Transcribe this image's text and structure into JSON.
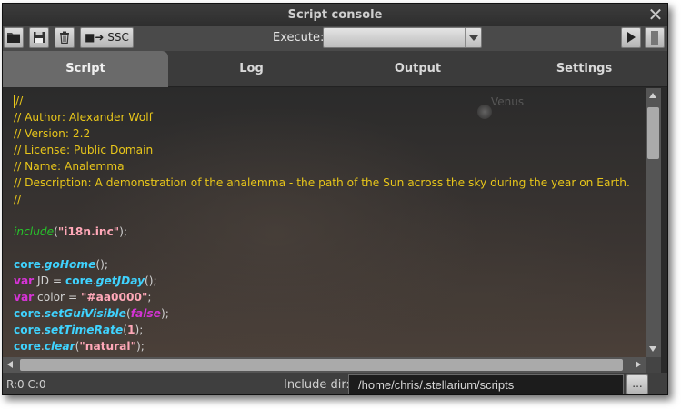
{
  "window": {
    "title": "Script console"
  },
  "toolbar": {
    "ssc_label": "SSC",
    "execute_label": "Execute:",
    "execute_value": ""
  },
  "tabs": [
    {
      "label": "Script",
      "active": true
    },
    {
      "label": "Log",
      "active": false
    },
    {
      "label": "Output",
      "active": false
    },
    {
      "label": "Settings",
      "active": false
    }
  ],
  "editor": {
    "background_label": "Venus",
    "lines": [
      [
        {
          "t": "//",
          "c": "cmt"
        }
      ],
      [
        {
          "t": "// Author: Alexander Wolf",
          "c": "cmt"
        }
      ],
      [
        {
          "t": "// Version: 2.2",
          "c": "cmt"
        }
      ],
      [
        {
          "t": "// License: Public Domain",
          "c": "cmt"
        }
      ],
      [
        {
          "t": "// Name: Analemma",
          "c": "cmt"
        }
      ],
      [
        {
          "t": "// Description: A demonstration of the analemma - the path of the Sun across the sky during the year on Earth.",
          "c": "cmt"
        }
      ],
      [
        {
          "t": "//",
          "c": "cmt"
        }
      ],
      [],
      [
        {
          "t": "include",
          "c": "inc"
        },
        {
          "t": "(",
          "c": "plain"
        },
        {
          "t": "\"i18n.inc\"",
          "c": "str"
        },
        {
          "t": ");",
          "c": "plain"
        }
      ],
      [],
      [
        {
          "t": "core",
          "c": "obj"
        },
        {
          "t": ".",
          "c": "plain"
        },
        {
          "t": "goHome",
          "c": "fn"
        },
        {
          "t": "();",
          "c": "plain"
        }
      ],
      [
        {
          "t": "var",
          "c": "kw"
        },
        {
          "t": " JD = ",
          "c": "plain"
        },
        {
          "t": "core",
          "c": "obj"
        },
        {
          "t": ".",
          "c": "plain"
        },
        {
          "t": "getJDay",
          "c": "fn"
        },
        {
          "t": "();",
          "c": "plain"
        }
      ],
      [
        {
          "t": "var",
          "c": "kw"
        },
        {
          "t": " color = ",
          "c": "plain"
        },
        {
          "t": "\"#aa0000\"",
          "c": "str"
        },
        {
          "t": ";",
          "c": "plain"
        }
      ],
      [
        {
          "t": "core",
          "c": "obj"
        },
        {
          "t": ".",
          "c": "plain"
        },
        {
          "t": "setGuiVisible",
          "c": "fn"
        },
        {
          "t": "(",
          "c": "plain"
        },
        {
          "t": "false",
          "c": "bool"
        },
        {
          "t": ");",
          "c": "plain"
        }
      ],
      [
        {
          "t": "core",
          "c": "obj"
        },
        {
          "t": ".",
          "c": "plain"
        },
        {
          "t": "setTimeRate",
          "c": "fn"
        },
        {
          "t": "(",
          "c": "plain"
        },
        {
          "t": "1",
          "c": "num"
        },
        {
          "t": ");",
          "c": "plain"
        }
      ],
      [
        {
          "t": "core",
          "c": "obj"
        },
        {
          "t": ".",
          "c": "plain"
        },
        {
          "t": "clear",
          "c": "fn"
        },
        {
          "t": "(",
          "c": "plain"
        },
        {
          "t": "\"natural\"",
          "c": "str"
        },
        {
          "t": ");",
          "c": "plain"
        }
      ]
    ]
  },
  "status": {
    "position": "R:0 C:0",
    "include_label": "Include dir:",
    "include_value": "/home/chris/.stellarium/scripts",
    "browse_label": "..."
  }
}
